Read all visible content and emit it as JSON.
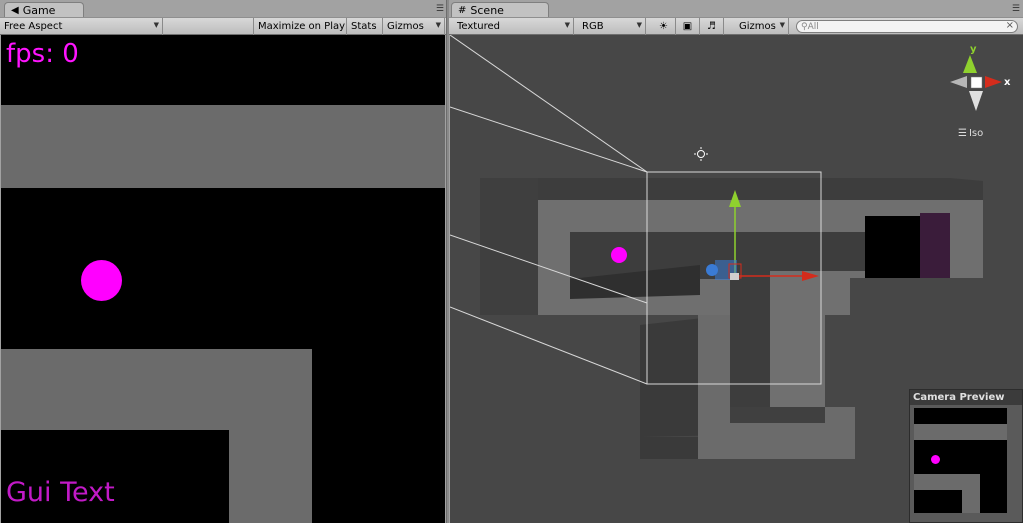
{
  "game": {
    "tab_label": "Game",
    "aspect": "Free Aspect",
    "maximize": "Maximize on Play",
    "stats": "Stats",
    "gizmos": "Gizmos",
    "fps_text": "fps: 0",
    "gui_text": "Gui Text"
  },
  "scene": {
    "tab_label": "Scene",
    "render_mode": "Textured",
    "color_mode": "RGB",
    "gizmos": "Gizmos",
    "search_placeholder": "All",
    "axis_x": "x",
    "axis_y": "y",
    "iso_label": "Iso",
    "camera_preview_title": "Camera Preview"
  },
  "colors": {
    "ball": "#ff00ff",
    "fps_text": "#ff14ff",
    "gui_text": "#c21ac7",
    "wall_gray": "#6b6b6b",
    "scene_bg": "#474747",
    "axis_x": "#d42c1c",
    "axis_y": "#8fd12e",
    "axis_z": "#3a7bd5"
  }
}
